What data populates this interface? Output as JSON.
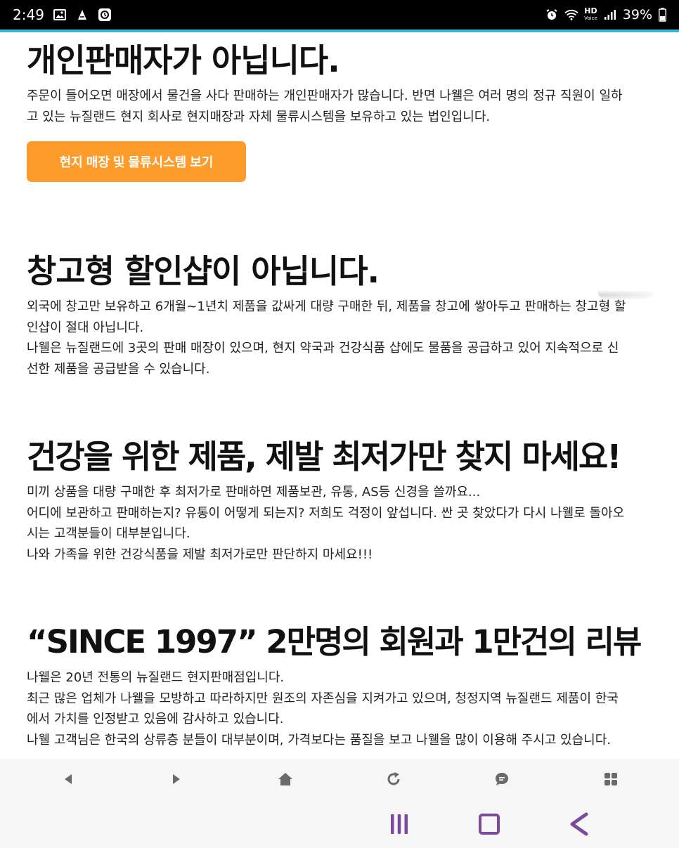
{
  "status_bar": {
    "time": "2:49",
    "battery": "39%",
    "hd_badge_top": "HD",
    "hd_badge_bottom": "Voice",
    "icons": [
      "gallery-icon",
      "notification-icon",
      "app-icon",
      "alarm-icon",
      "wifi-icon",
      "signal-icon",
      "battery-icon"
    ]
  },
  "sections": [
    {
      "heading": "개인판매자가 아닙니다.",
      "lines": [
        "주문이 들어오면 매장에서 물건을 사다 판매하는 개인판매자가 많습니다. 반면 나웰은 여러 명의 정규 직원이 일하",
        "고 있는 뉴질랜드 현지 회사로 현지매장과 자체 물류시스템을 보유하고 있는 법인입니다."
      ],
      "button": "현지 매장 및 물류시스템 보기"
    },
    {
      "heading": "창고형 할인샵이 아닙니다.",
      "lines": [
        "외국에 창고만 보유하고 6개월~1년치 제품을 값싸게 대량 구매한 뒤, 제품을 창고에 쌓아두고 판매하는 창고형 할",
        "인샵이 절대 아닙니다.",
        "나웰은 뉴질랜드에 3곳의 판매 매장이 있으며, 현지 약국과 건강식품 샵에도 물품을 공급하고 있어 지속적으로 신",
        "선한 제품을 공급받을 수 있습니다."
      ]
    },
    {
      "heading": "건강을 위한 제품, 제발 최저가만 찾지 마세요!",
      "lines": [
        "미끼 상품을 대량 구매한 후 최저가로 판매하면 제품보관, 유통, AS등 신경을 쓸까요...",
        "어디에 보관하고 판매하는지? 유통이 어떻게 되는지? 저희도 걱정이 앞섭니다. 싼 곳 찾았다가 다시 나웰로 돌아오",
        "시는 고객분들이 대부분입니다.",
        "나와 가족을 위한 건강식품을 제발 최저가로만 판단하지 마세요!!!"
      ]
    },
    {
      "heading": "“SINCE 1997” 2만명의 회원과 1만건의 리뷰",
      "lines": [
        "나웰은 20년 전통의 뉴질랜드 현지판매점입니다.",
        "최근 많은 업체가 나웰을 모방하고 따라하지만 원조의 자존심을 지켜가고 있으며, 청정지역 뉴질랜드 제품이 한국",
        "에서 가치를 인정받고 있음에 감사하고 있습니다.",
        "나웰 고객님은 한국의 상류층 분들이 대부분이며, 가격보다는 품질을 보고 나웰을 많이 이용해 주시고 있습니다."
      ]
    }
  ],
  "colors": {
    "accent": "#fd9b2b",
    "status_bar_line": "#39b8d6",
    "nav_icon": "#7a4b9a",
    "toolbar_icon": "#6a6a6a"
  },
  "browser_toolbar": [
    "back-icon",
    "forward-icon",
    "home-icon",
    "refresh-icon",
    "chat-icon",
    "menu-grid-icon"
  ],
  "nav_bar": [
    "recent-apps-icon",
    "home-square-icon",
    "back-arrow-icon"
  ]
}
